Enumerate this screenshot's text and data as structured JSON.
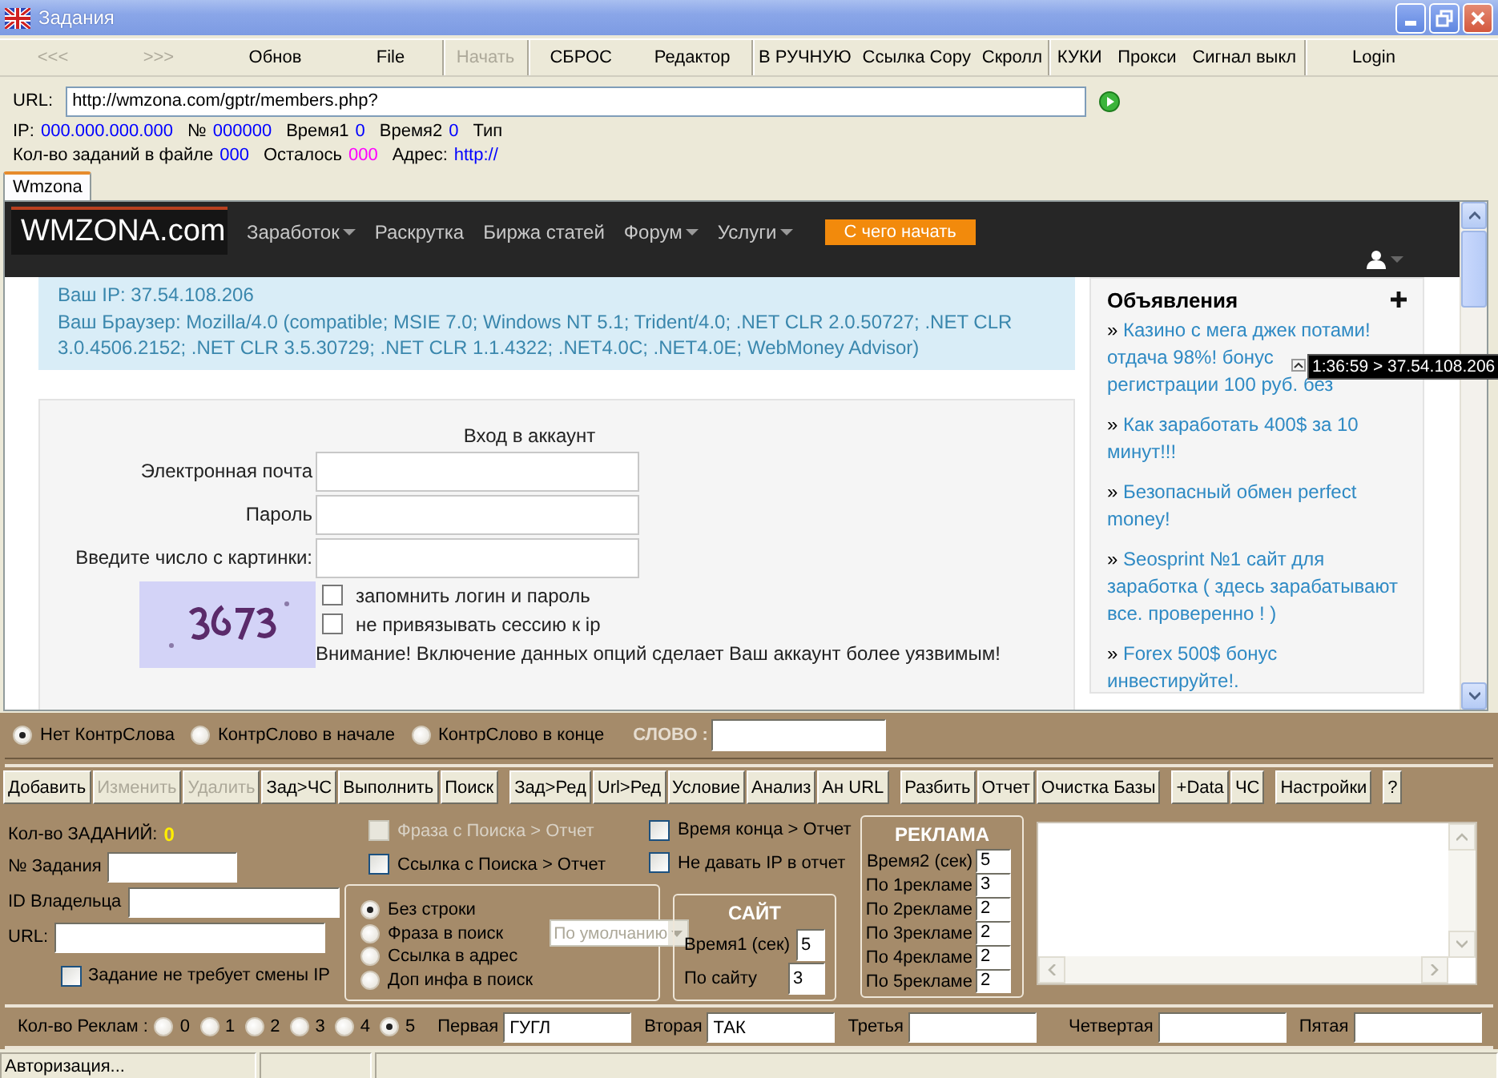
{
  "window": {
    "title": "Задания"
  },
  "toolbar": [
    [
      {
        "label": "<<<",
        "disabled": true
      },
      {
        "label": ">>>",
        "disabled": true
      },
      {
        "label": "Обнов",
        "disabled": false
      },
      {
        "label": "File",
        "disabled": false
      }
    ],
    [
      {
        "label": "Начать",
        "disabled": true
      }
    ],
    [
      {
        "label": "СБРОС",
        "disabled": false
      },
      {
        "label": "Редактор",
        "disabled": false
      }
    ],
    [
      {
        "label": "В РУЧНУЮ",
        "disabled": false
      },
      {
        "label": "Ссылка Copy",
        "disabled": false
      },
      {
        "label": "Скролл",
        "disabled": false
      }
    ],
    [
      {
        "label": "КУКИ",
        "disabled": false
      },
      {
        "label": "Прокси",
        "disabled": false
      },
      {
        "label": "Сигнал выкл",
        "disabled": false
      }
    ],
    [
      {
        "label": "Login",
        "disabled": false
      }
    ]
  ],
  "address": {
    "label": "URL:",
    "value": "http://wmzona.com/gptr/members.php?"
  },
  "info_lines": [
    [
      {
        "label": "IP:",
        "value": "000.000.000.000",
        "color": "#0000ff"
      },
      {
        "label": "№",
        "value": "000000",
        "color": "#0000ff"
      },
      {
        "label": "Время1",
        "value": "0",
        "color": "#0000ff"
      },
      {
        "label": "Время2",
        "value": "0",
        "color": "#0000ff"
      },
      {
        "label": "Тип"
      }
    ],
    [
      {
        "label": "Кол-во заданий в файле",
        "value": "000",
        "color": "#0000ff"
      },
      {
        "label": "Осталось",
        "value": "000",
        "color": "#ff00ff"
      },
      {
        "label": "Адрес:",
        "value": "http://",
        "color": "#0000ff"
      }
    ]
  ],
  "tabs": [
    {
      "label": "Wmzona",
      "selected": true
    }
  ],
  "web_page": {
    "logo": "WMZONA.com",
    "nav": [
      {
        "label": "Заработок",
        "dropdown": true
      },
      {
        "label": "Раскрутка",
        "dropdown": false
      },
      {
        "label": "Биржа статей",
        "dropdown": false
      },
      {
        "label": "Форум",
        "dropdown": true
      },
      {
        "label": "Услуги",
        "dropdown": true
      }
    ],
    "cta": "С чего начать",
    "visitor_info": [
      "Ваш IP: 37.54.108.206",
      "Ваш Браузер: Mozilla/4.0 (compatible; MSIE 7.0; Windows NT 5.1; Trident/4.0; .NET CLR 2.0.50727; .NET CLR 3.0.4506.2152; .NET CLR 3.5.30729; .NET CLR 1.1.4322; .NET4.0C; .NET4.0E; WebMoney Advisor)"
    ],
    "login": {
      "title": "Вход в аккаунт",
      "fields": [
        {
          "label": "Электронная почта"
        },
        {
          "label": "Пароль"
        },
        {
          "label": "Введите число с картинки:"
        }
      ],
      "options": [
        {
          "label": "запомнить логин и пароль",
          "checked": false
        },
        {
          "label": "не привязывать сессию к ip",
          "checked": false
        }
      ],
      "warning": "Внимание! Включение данных опций сделает Ваш аккаунт более уязвимым!"
    },
    "sidebar": {
      "title": "Объявления",
      "ads": [
        {
          "marker": "»",
          "parts": [
            "Казино с мега джек потами!",
            "отдача 98%! бонус",
            "регистрации 100 руб. без"
          ]
        },
        {
          "marker": "»",
          "parts": [
            "Как заработать 400$ за 10 минут!!!"
          ]
        },
        {
          "marker": "»",
          "parts": [
            "Безопасный обмен perfect money!"
          ]
        },
        {
          "marker": "»",
          "parts": [
            "Seosprint №1 сайт для заработка ( здесь зарабатывают все. проверенно ! )"
          ]
        },
        {
          "marker": "»",
          "parts": [
            "Forex 500$ бонус инвестируйте!."
          ]
        }
      ]
    }
  },
  "tooltip": "1:36:59 > 37.54.108.206",
  "control_word": {
    "options": [
      {
        "label": "Нет КонтрСлова",
        "selected": true
      },
      {
        "label": "КонтрСлово в начале",
        "selected": false
      },
      {
        "label": "КонтрСлово в конце",
        "selected": false
      }
    ],
    "word_label": "СЛОВО :"
  },
  "actions": [
    [
      {
        "label": "Добавить",
        "disabled": false
      },
      {
        "label": "Изменить",
        "disabled": true
      },
      {
        "label": "Удалить",
        "disabled": true
      },
      {
        "label": "Зад>ЧС",
        "disabled": false
      },
      {
        "label": "Выполнить",
        "disabled": false
      },
      {
        "label": "Поиск",
        "disabled": false
      }
    ],
    [
      {
        "label": "Зад>Ред",
        "disabled": false
      },
      {
        "label": "Url>Ред",
        "disabled": false
      },
      {
        "label": "Условие",
        "disabled": false
      },
      {
        "label": "Анализ",
        "disabled": false
      },
      {
        "label": "Ан URL",
        "disabled": false
      }
    ],
    [
      {
        "label": "Разбить",
        "disabled": false
      },
      {
        "label": "Отчет",
        "disabled": false
      },
      {
        "label": "Очистка Базы",
        "disabled": false
      }
    ],
    [
      {
        "label": "+Data",
        "disabled": false
      },
      {
        "label": "ЧС",
        "disabled": false
      }
    ],
    [
      {
        "label": "Настройки",
        "disabled": false
      }
    ],
    [
      {
        "label": "?",
        "disabled": false
      }
    ]
  ],
  "task": {
    "count_label": "Кол-во ЗАДАНИЙ:",
    "count": "0",
    "fields": [
      {
        "label": "№ Задания"
      },
      {
        "label": "ID Владельца"
      },
      {
        "label": "URL:"
      }
    ],
    "no_ip_change": {
      "label": "Задание не требует смены IP",
      "checked": false
    }
  },
  "report_options": [
    [
      {
        "label": "Фраза с Поиска > Отчет",
        "checked": false,
        "disabled": true
      },
      {
        "label": "Ссылка с Поиска > Отчет",
        "checked": false,
        "disabled": false
      }
    ],
    [
      {
        "label": "Время конца > Отчет",
        "checked": false,
        "disabled": false
      },
      {
        "label": "Не давать IP в отчет",
        "checked": false,
        "disabled": false
      }
    ]
  ],
  "search_mode": {
    "options": [
      {
        "label": "Без строки",
        "selected": true
      },
      {
        "label": "Фраза в поиск",
        "selected": false
      },
      {
        "label": "Ссылка в адрес",
        "selected": false
      },
      {
        "label": "Доп инфа в поиск",
        "selected": false
      }
    ],
    "dropdown": {
      "value": "По умолчанию",
      "disabled": true
    }
  },
  "site": {
    "title": "САЙТ",
    "fields": [
      {
        "label": "Время1 (сек)",
        "value": "5"
      },
      {
        "label": "По сайту",
        "value": "3"
      }
    ]
  },
  "ads": {
    "title": "РЕКЛАМА",
    "fields": [
      {
        "label": "Время2 (сек)",
        "value": "5"
      },
      {
        "label": "По 1рекламе",
        "value": "3"
      },
      {
        "label": "По 2рекламе",
        "value": "2"
      },
      {
        "label": "По 3рекламе",
        "value": "2"
      },
      {
        "label": "По 4рекламе",
        "value": "2"
      },
      {
        "label": "По 5рекламе",
        "value": "2"
      }
    ]
  },
  "ad_count": {
    "label": "Кол-во Реклам :",
    "options": [
      {
        "label": "0",
        "selected": false
      },
      {
        "label": "1",
        "selected": false
      },
      {
        "label": "2",
        "selected": false
      },
      {
        "label": "3",
        "selected": false
      },
      {
        "label": "4",
        "selected": false
      },
      {
        "label": "5",
        "selected": true
      }
    ],
    "slots": [
      {
        "label": "Первая",
        "value": "ГУГЛ"
      },
      {
        "label": "Вторая",
        "value": "ТАК"
      },
      {
        "label": "Третья"
      },
      {
        "label": "Четвертая"
      },
      {
        "label": "Пятая"
      }
    ]
  },
  "status_bar": {
    "text": "Авторизация..."
  }
}
